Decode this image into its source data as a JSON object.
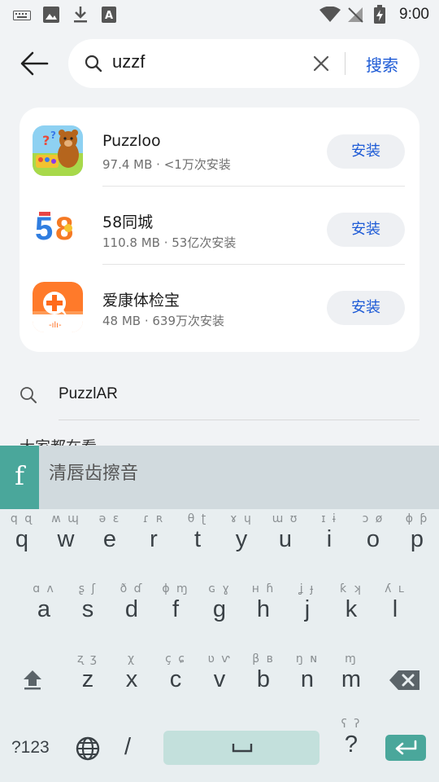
{
  "status_bar": {
    "time": "9:00"
  },
  "search": {
    "query": "uzzf",
    "submit_label": "搜索"
  },
  "apps": [
    {
      "name": "Puzzloo",
      "meta": "97.4 MB · <1万次安装",
      "install_label": "安装",
      "icon": "puzzloo-bear-icon"
    },
    {
      "name": "58同城",
      "meta": "110.8 MB · 53亿次安装",
      "install_label": "安装",
      "icon": "58-logo-icon"
    },
    {
      "name": "爱康体检宝",
      "meta": "48 MB · 639万次安装",
      "install_label": "安装",
      "icon": "medical-plus-icon"
    }
  ],
  "suggestion": {
    "text": "PuzzlAR"
  },
  "section_title": "大家都在看",
  "keyboard": {
    "logo_letter": "f",
    "candidate": "清唇齿擦音",
    "row1": [
      {
        "key": "q",
        "alt": "q ɋ"
      },
      {
        "key": "w",
        "alt": "ʍ ɰ"
      },
      {
        "key": "e",
        "alt": "ə ɛ"
      },
      {
        "key": "r",
        "alt": "ɾ ʀ"
      },
      {
        "key": "t",
        "alt": "θ ʈ"
      },
      {
        "key": "y",
        "alt": "ɤ ɥ"
      },
      {
        "key": "u",
        "alt": "ɯ ʊ"
      },
      {
        "key": "i",
        "alt": "ɪ ɨ"
      },
      {
        "key": "o",
        "alt": "ɔ ø"
      },
      {
        "key": "p",
        "alt": "ɸ ƥ"
      }
    ],
    "row2": [
      {
        "key": "a",
        "alt": "ɑ ʌ"
      },
      {
        "key": "s",
        "alt": "ʂ ʃ"
      },
      {
        "key": "d",
        "alt": "ð ɗ"
      },
      {
        "key": "f",
        "alt": "ɸ ɱ"
      },
      {
        "key": "g",
        "alt": "ɢ ɣ"
      },
      {
        "key": "h",
        "alt": "ʜ ɦ"
      },
      {
        "key": "j",
        "alt": "ʝ ɟ"
      },
      {
        "key": "k",
        "alt": "ƙ ʞ"
      },
      {
        "key": "l",
        "alt": "ʎ ʟ"
      }
    ],
    "row3": [
      {
        "key": "z",
        "alt": "ʐ ʒ"
      },
      {
        "key": "x",
        "alt": "χ"
      },
      {
        "key": "c",
        "alt": "ç ɕ"
      },
      {
        "key": "v",
        "alt": "ʋ ⱱ"
      },
      {
        "key": "b",
        "alt": "β ʙ"
      },
      {
        "key": "n",
        "alt": "ŋ ɴ"
      },
      {
        "key": "m",
        "alt": "ɱ"
      }
    ],
    "symbols_label": "?123",
    "slash": "/",
    "question": "?",
    "question_alt": "ʕ ʔ"
  },
  "colors": {
    "accent_blue": "#1e5bd6",
    "keyboard_teal": "#4aa79b",
    "space_key": "#c3e0dc"
  }
}
